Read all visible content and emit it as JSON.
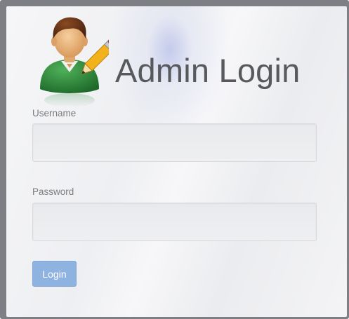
{
  "header": {
    "title": "Admin Login",
    "icon": "admin-user-edit-icon"
  },
  "form": {
    "username_label": "Username",
    "username_value": "",
    "password_label": "Password",
    "password_value": "",
    "login_label": "Login"
  },
  "colors": {
    "frame": "#7d7f84",
    "title_text": "#58595d",
    "button": "#8fb3e0",
    "avatar_shirt": "#2f8a3c",
    "pencil": "#f2b21c"
  }
}
